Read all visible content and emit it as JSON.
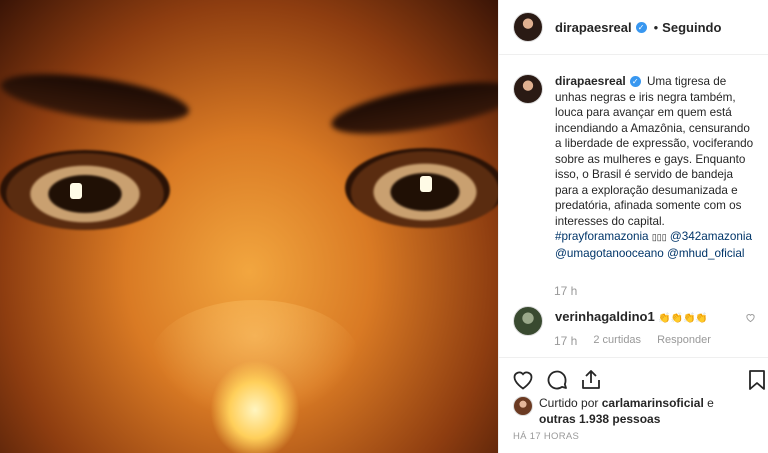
{
  "post": {
    "username": "dirapaesreal",
    "follow_status": "Seguindo",
    "separator": "•",
    "caption": "Uma tigresa de unhas negras e iris negra também, louca para avançar em quem está incendiando a Amazônia, censurando a liberdade de expressão, vociferando sobre as mulheres e gays. Enquanto isso, o Brasil é servido de bandeja para a exploração desumanizada e predatória, afinada somente com os interesses do capital.",
    "hashtag": "#prayforamazonia",
    "emoji_placeholder": "▯▯▯",
    "mentions": [
      "@342amazonia",
      "@umagotanooceano",
      "@mhud_oficial"
    ],
    "caption_time": "17 h"
  },
  "reply": {
    "username": "verinhagaldino1",
    "text": "👏👏👏👏",
    "time": "17 h",
    "likes": "2 curtidas",
    "reply_label": "Responder"
  },
  "likes": {
    "prefix": "Curtido por",
    "user": "carlamarinsoficial",
    "conj": "e",
    "others": "outras 1.938 pessoas"
  },
  "timestamp": "HÁ 17 HORAS",
  "icons": [
    "heart-icon",
    "comment-icon",
    "share-icon",
    "bookmark-icon"
  ]
}
